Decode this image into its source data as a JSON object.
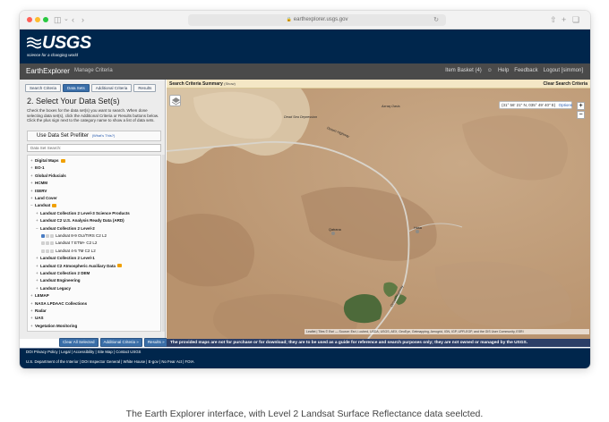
{
  "browser": {
    "url": "earthexplorer.usgs.gov",
    "colors": {
      "close": "#ff5f57",
      "minimize": "#febc2e",
      "zoom": "#28c840"
    },
    "icons": [
      "sidebar-icon",
      "chevron-down-icon",
      "back-icon",
      "forward-icon",
      "lock-icon",
      "reload-icon",
      "share-icon",
      "new-tab-icon",
      "tabs-icon"
    ]
  },
  "header": {
    "logo_text": "USGS",
    "tagline": "science for a changing world",
    "app_title": "EarthExplorer",
    "manage_criteria": "Manage Criteria",
    "item_basket": "Item Basket (4)",
    "help": "Help",
    "feedback": "Feedback",
    "logout": "Logout [simmon]"
  },
  "left_panel": {
    "tabs": [
      {
        "label": "Search Criteria"
      },
      {
        "label": "Data Sets"
      },
      {
        "label": "Additional Criteria"
      },
      {
        "label": "Results"
      }
    ],
    "step_title": "2. Select Your Data Set(s)",
    "instructions": "Check the boxes for the data set(s) you want to search. When done selecting data set(s), click the Additional Criteria or Results buttons below. Click the plus sign next to the category name to show a list of data sets.",
    "profiler_label": "Use Data Set Prefilter",
    "profiler_note": "(What's This?)",
    "search_placeholder": "Data Set Search:",
    "tree": [
      {
        "label": "Digital Maps",
        "level": 0,
        "sign": "+",
        "info": true
      },
      {
        "label": "EO-1",
        "level": 0,
        "sign": "+"
      },
      {
        "label": "Global Fiducials",
        "level": 0,
        "sign": "+"
      },
      {
        "label": "HCMM",
        "level": 0,
        "sign": "+"
      },
      {
        "label": "ISERV",
        "level": 0,
        "sign": "+"
      },
      {
        "label": "Land Cover",
        "level": 0,
        "sign": "+"
      },
      {
        "label": "Landsat",
        "level": 0,
        "sign": "−",
        "info": true
      },
      {
        "label": "Landsat Collection 2 Level-3 Science Products",
        "level": 1,
        "sign": "+"
      },
      {
        "label": "Landsat C2 U.S. Analysis Ready Data (ARD)",
        "level": 1,
        "sign": "+"
      },
      {
        "label": "Landsat Collection 2 Level-2",
        "level": 1,
        "sign": "−"
      },
      {
        "label": "Landsat 8-9 OLI/TIRS C2 L2",
        "level": 2,
        "checked": true
      },
      {
        "label": "Landsat 7 ETM+ C2 L2",
        "level": 2,
        "checked": false
      },
      {
        "label": "Landsat 4-5 TM C2 L2",
        "level": 2,
        "checked": false
      },
      {
        "label": "Landsat Collection 2 Level-1",
        "level": 1,
        "sign": "+"
      },
      {
        "label": "Landsat C2 Atmospheric Auxiliary Data",
        "level": 1,
        "sign": "+",
        "info": true
      },
      {
        "label": "Landsat Collection 2 DEM",
        "level": 1,
        "sign": "+"
      },
      {
        "label": "Landsat Engineering",
        "level": 1,
        "sign": "+"
      },
      {
        "label": "Landsat Legacy",
        "level": 1,
        "sign": "+"
      },
      {
        "label": "LEMAP",
        "level": 0,
        "sign": "+"
      },
      {
        "label": "NASA LPDAAC Collections",
        "level": 0,
        "sign": "+"
      },
      {
        "label": "Radar",
        "level": 0,
        "sign": "+"
      },
      {
        "label": "UAS",
        "level": 0,
        "sign": "+"
      },
      {
        "label": "Vegetation Monitoring",
        "level": 0,
        "sign": "+"
      }
    ],
    "buttons": {
      "clear": "Clear All Selected",
      "additional": "Additional Criteria »",
      "results": "Results »"
    }
  },
  "map": {
    "summary_title": "Search Criteria Summary",
    "summary_show": "(Show)",
    "clear_label": "Clear Search Criteria",
    "coordinates": "(31° 56' 21\" N, 035° 49' 40\" E)",
    "options_label": "Options",
    "zoom_in": "+",
    "zoom_out": "−",
    "labels": {
      "a": "Dead Sea Depression",
      "b": "Azraq Oasis",
      "c": "Desert Highway",
      "d": "Qatrana",
      "e": "Hasa",
      "f": "Desert Highway"
    },
    "attribution": "Leaflet | Tiles © Esri — Source: Esri, i-cubed, USDA, USGS, AEX, GeoEye, Getmapping, Aerogrid, IGN, IGP, UPR-EGP, and the GIS User Community, ESRI",
    "disclaimer": "The provided maps are not for purchase or for download; they are to be used as a guide for reference and search purposes only; they are not owned or managed by the USGS."
  },
  "footer": {
    "row1": "DOI Privacy Policy | Legal | Accessibility | Site Map | Contact USGS",
    "row2": "U.S. Department of the Interior | DOI Inspector General | White House | E-gov | No Fear Act | FOIA"
  },
  "caption": "The Earth Explorer interface, with Level 2 Landsat Surface Reflectance data seelcted."
}
